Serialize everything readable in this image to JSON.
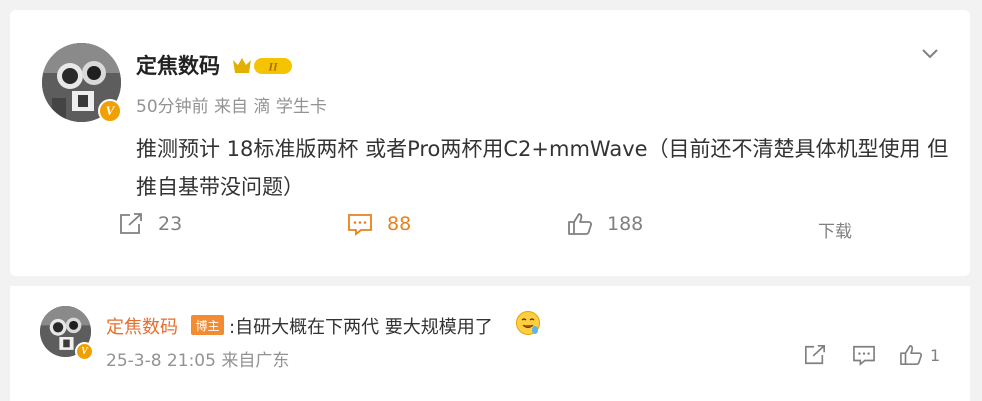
{
  "post": {
    "author": "定焦数码",
    "level_badge": "II",
    "verified_mark": "V",
    "meta": "50分钟前 来自 滴 学生卡",
    "text": "推测预计 18标准版两杯 或者Pro两杯用C2+mmWave（目前还不清楚具体机型使用 但推自基带没问题）",
    "actions": {
      "repost": "23",
      "comment": "88",
      "like": "188",
      "download": "下载"
    },
    "comment_color": "#e8811b"
  },
  "reply": {
    "author": "定焦数码",
    "author_tag": "博主",
    "text": ":自研大概在下两代 要大规模用了",
    "emoji": "drooling-face-emoji",
    "meta": "25-3-8 21:05 来自广东",
    "like_count": "1"
  }
}
